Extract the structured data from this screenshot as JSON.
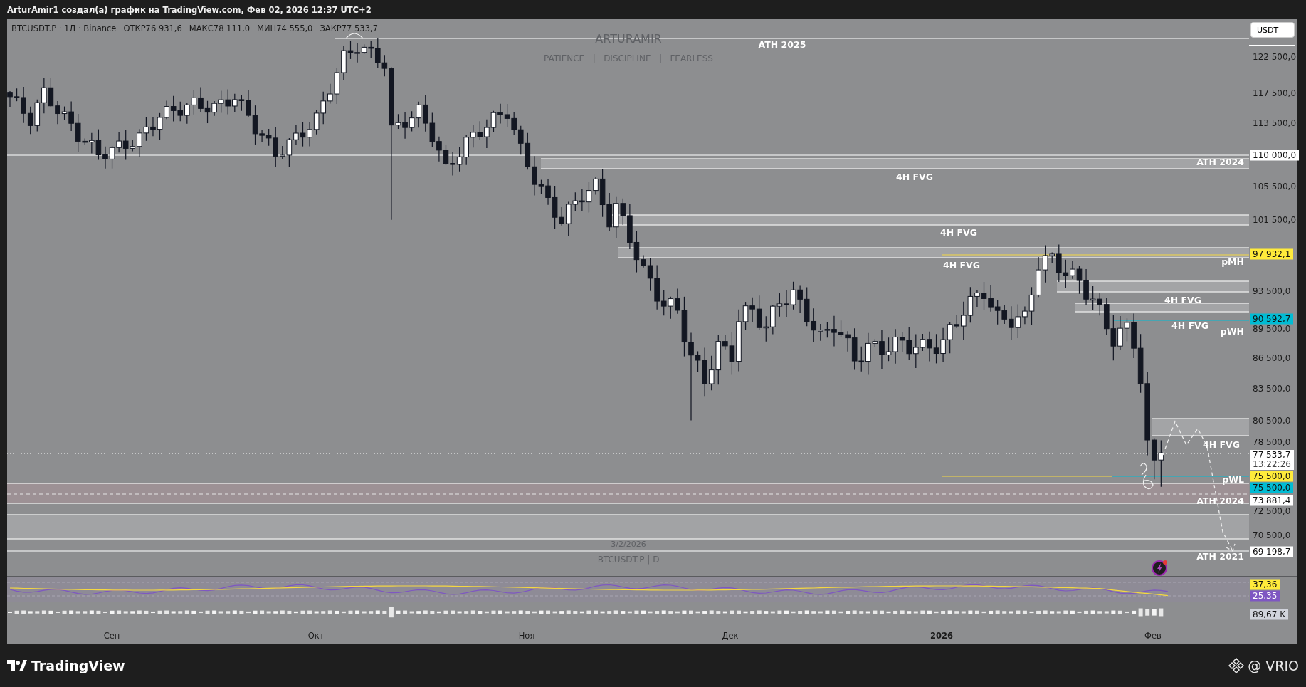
{
  "header": {
    "text": "ArturAmir1 создал(а) график на TradingView.com, Фев 02, 2026 12:37 UTC+2"
  },
  "legend": {
    "symbol": "BTCUSDT.P · 1Д · Binance",
    "ohlc": [
      {
        "label": "ОТКР",
        "value": "76 931,6"
      },
      {
        "label": "МАКС",
        "value": "78 111,0"
      },
      {
        "label": "МИН",
        "value": "74 555,0"
      },
      {
        "label": "ЗАКР",
        "value": "77 533,7"
      }
    ]
  },
  "watermark": {
    "title": "ARTURAMIR",
    "tagline": "PATIENCE   |   DISCIPLINE   |   FEARLESS",
    "date": "3/2/2026",
    "symbol": "BTCUSDT.P | D"
  },
  "annotations": [
    {
      "text": "ATH 2025"
    },
    {
      "text": "ATH 2024"
    },
    {
      "text": "4H FVG"
    },
    {
      "text": "4H FVG"
    },
    {
      "text": "4H FVG"
    },
    {
      "text": "pMH"
    },
    {
      "text": "4H FVG"
    },
    {
      "text": "4H FVG"
    },
    {
      "text": "pWH"
    },
    {
      "text": "4H FVG"
    },
    {
      "text": "pWL"
    },
    {
      "text": "ATH 2024"
    },
    {
      "text": "ATH 2021"
    }
  ],
  "price_axis": {
    "currency": "USDT",
    "ticks": [
      "122 500,0",
      "117 500,0",
      "113 500,0",
      "105 500,0",
      "101 500,0",
      "93 500,0",
      "89 500,0",
      "86 500,0",
      "83 500,0",
      "80 500,0",
      "78 500,0",
      "72 500,0",
      "70 500,0"
    ],
    "badges": [
      {
        "text": "110 000,0",
        "color": "#ffffff"
      },
      {
        "text": "97 932,1",
        "color": "#ffeb3b"
      },
      {
        "text": "90 592,7",
        "color": "#00bcd4"
      },
      {
        "text": "77 533,7",
        "sub": "13:22:26",
        "color": "#ffffff"
      },
      {
        "text": "75 500,0",
        "color": "#ffeb3b"
      },
      {
        "text": "75 500,0",
        "color": "#00bcd4"
      },
      {
        "text": "73 881,4",
        "color": "#ffffff"
      },
      {
        "text": "69 198,7",
        "color": "#ffffff"
      }
    ]
  },
  "rsi": {
    "badges": [
      {
        "text": "37,36",
        "color": "#ffeb3b"
      },
      {
        "text": "25,35",
        "color": "#7e57c2"
      }
    ]
  },
  "volume": {
    "badges": [
      {
        "text": "89,67 K",
        "color": "#d1d4dc"
      }
    ]
  },
  "time_axis": [
    {
      "text": "Сен",
      "kind": "month"
    },
    {
      "text": "Окт",
      "kind": "month"
    },
    {
      "text": "Ноя",
      "kind": "month"
    },
    {
      "text": "Дек",
      "kind": "month"
    },
    {
      "text": "2026",
      "kind": "year"
    },
    {
      "text": "Фев",
      "kind": "month"
    }
  ],
  "footer": {
    "brand": "TradingView",
    "credit": "@ VRIO"
  }
}
